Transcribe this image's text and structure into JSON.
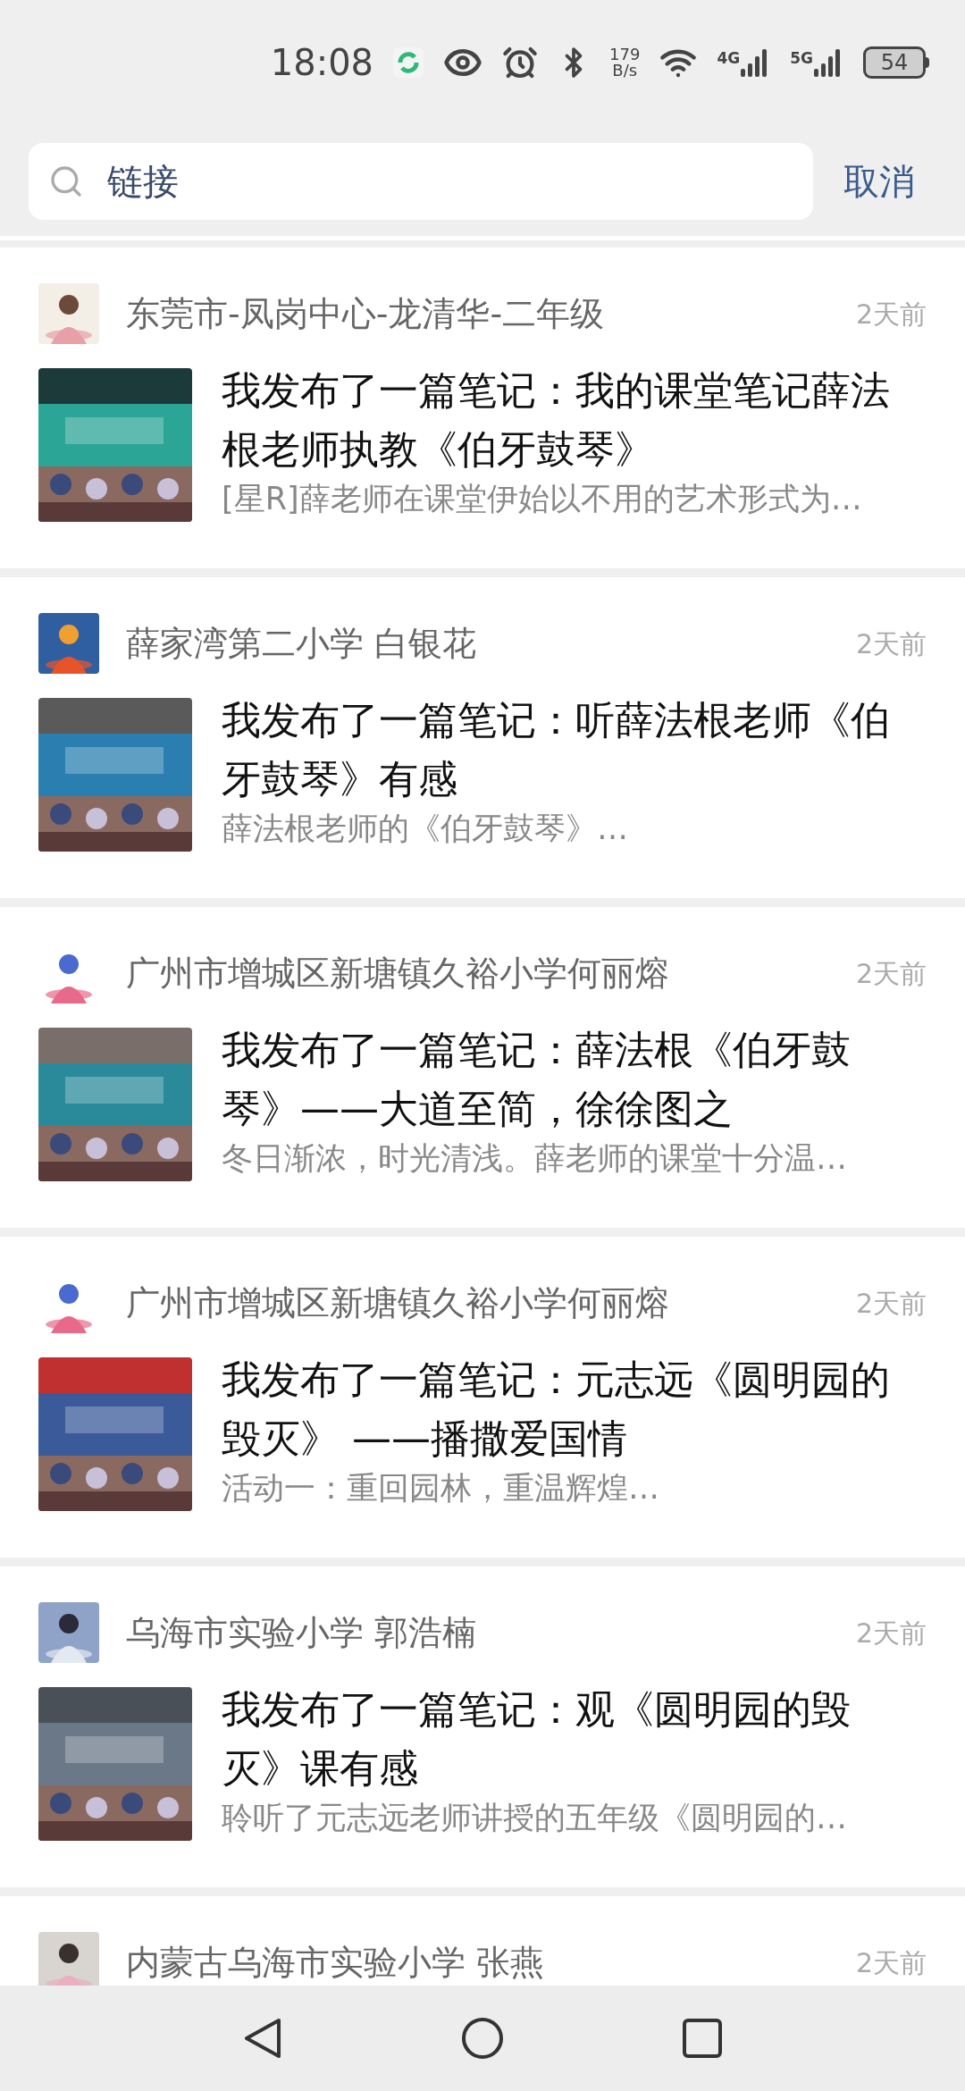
{
  "status_bar": {
    "time": "18:08",
    "speed_value": "179",
    "speed_unit": "B/s",
    "networks": [
      "4G",
      "5G"
    ],
    "battery": "54"
  },
  "search": {
    "value": "链接",
    "cancel": "取消"
  },
  "feed": [
    {
      "author": "东莞市-凤岗中心-龙清华-二年级",
      "time": "2天前",
      "title": "我发布了一篇笔记：我的课堂笔记薛法根老师执教《伯牙鼓琴》",
      "summary": "[星R]薛老师在课堂伊始以不用的艺术形式为…"
    },
    {
      "author": "薛家湾第二小学 白银花",
      "time": "2天前",
      "title": "我发布了一篇笔记：听薛法根老师《伯牙鼓琴》有感",
      "summary": "薛法根老师的《伯牙鼓琴》…"
    },
    {
      "author": "广州市增城区新塘镇久裕小学何丽熔",
      "time": "2天前",
      "title": "我发布了一篇笔记：薛法根《伯牙鼓琴》——大道至简，徐徐图之",
      "summary": "冬日渐浓，时光清浅。薛老师的课堂十分温…"
    },
    {
      "author": "广州市增城区新塘镇久裕小学何丽熔",
      "time": "2天前",
      "title": "我发布了一篇笔记：元志远《圆明园的毁灭》 ——播撒爱国情",
      "summary": "活动一：重回园林，重温辉煌…"
    },
    {
      "author": "乌海市实验小学 郭浩楠",
      "time": "2天前",
      "title": "我发布了一篇笔记：观《圆明园的毁灭》课有感",
      "summary": "聆听了元志远老师讲授的五年级《圆明园的…"
    },
    {
      "author": "内蒙古乌海市实验小学  张燕",
      "time": "2天前"
    }
  ]
}
